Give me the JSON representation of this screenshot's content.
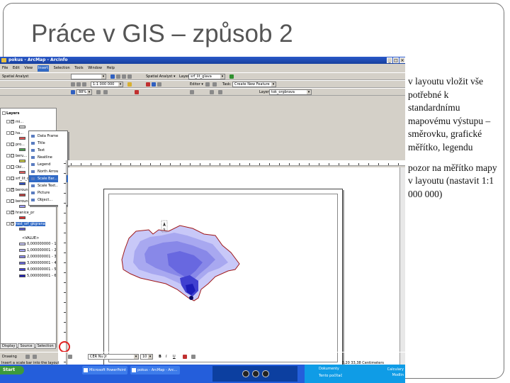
{
  "slide": {
    "title": "Práce v GIS – způsob 2",
    "notes": [
      "v layoutu vložit vše potřebné k standardnímu mapovému výstupu – směrovku, grafické měřítko, legendu",
      "pozor na měřítko mapy v layoutu (nastavit 1:1 000 000)"
    ]
  },
  "window": {
    "title": "pokus - ArcMap - ArcInfo",
    "menu": [
      "File",
      "Edit",
      "View",
      "Insert",
      "Selection",
      "Tools",
      "Window",
      "Help"
    ],
    "active_menu": "Insert"
  },
  "toolbars": {
    "editor_label": "Spatial Analyst",
    "layer_label": "Layer:",
    "layer_value": "srf_lit_glava",
    "scale_value": "1:1 000 000",
    "zoom_value": "88%",
    "target_label": "Target:",
    "target_value": "Create New Feature",
    "layer2_label": "Layer:",
    "layer2_value": "tok_orgbrava"
  },
  "insert_menu": {
    "items": [
      "Data Frame",
      "Title",
      "Text",
      "Neatline",
      "Legend",
      "North Arrow...",
      "Scale Bar...",
      "Scale Text...",
      "Picture",
      "Object..."
    ],
    "highlighted_index": 6
  },
  "toc": {
    "header": "Layers",
    "layers": [
      {
        "name": "mi...",
        "checked": true,
        "indent": 1
      },
      {
        "name": "ha...",
        "checked": false,
        "indent": 1
      },
      {
        "name": "pro...",
        "checked": false,
        "indent": 1
      },
      {
        "name": "beru...",
        "checked": false,
        "indent": 1
      },
      {
        "name": "Obl...",
        "checked": false,
        "indent": 1
      },
      {
        "name": "srf_lit_orgbrava_dna",
        "checked": false,
        "indent": 1
      },
      {
        "name": "berounka_dissolve",
        "checked": true,
        "indent": 1
      },
      {
        "name": "berounka",
        "checked": false,
        "indent": 1
      },
      {
        "name": "hranice_pr",
        "checked": true,
        "indent": 1
      },
      {
        "name": "rast_srf_gkgrana",
        "checked": true,
        "indent": 1,
        "selected": true
      }
    ],
    "legend_label": "<VALUE>",
    "legend_classes": [
      {
        "label": "0,000000000 - 1",
        "color": "#c8c8f8"
      },
      {
        "label": "1,000000001 - 2",
        "color": "#a8a8f0"
      },
      {
        "label": "2,000000001 - 3",
        "color": "#8888e8"
      },
      {
        "label": "3,000000001 - 4",
        "color": "#6868e0"
      },
      {
        "label": "4,000000001 - 5",
        "color": "#4040d0"
      },
      {
        "label": "5,000000001 - 6",
        "color": "#1c1cb8"
      }
    ]
  },
  "tabs": [
    "Display",
    "Source",
    "Selection"
  ],
  "draw_bar": {
    "drawing_label": "Drawing",
    "font_value": "CER Nu Jr",
    "size_value": "10",
    "bold": "B",
    "italic": "I",
    "underline": "U"
  },
  "status": {
    "left": "Insert a scale bar into the layout",
    "coords": "0,20  33,38 Centimeters"
  },
  "taskbar": {
    "start": "Start",
    "tasks": [
      "Microsoft PowerPoint - [...]",
      "pokus - ArcMap - Arc..."
    ],
    "tray_items": [
      "Dokumenty",
      "Tento počítač"
    ],
    "tray_right": [
      "Calculary",
      "Modlin"
    ]
  },
  "map": {
    "classes_colors": [
      "#c8c8f8",
      "#a8a8f0",
      "#8888e8",
      "#6868e0",
      "#4040d0",
      "#1c1cb8"
    ],
    "outline_color": "#a01818"
  }
}
